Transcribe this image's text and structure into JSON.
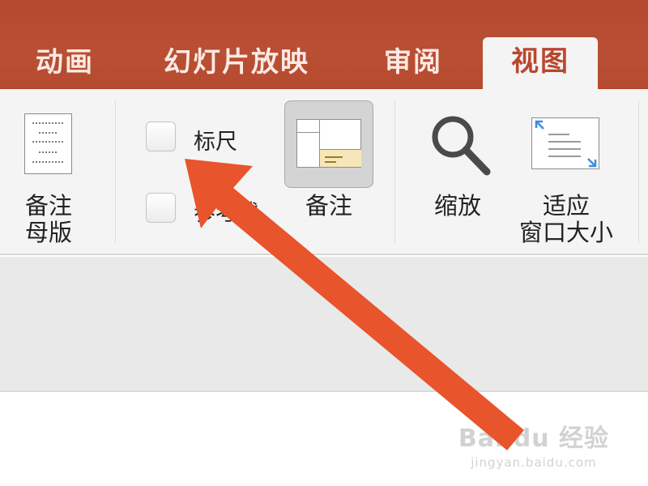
{
  "tabs": [
    {
      "label": "动画",
      "active": false
    },
    {
      "label": "幻灯片放映",
      "active": false
    },
    {
      "label": "审阅",
      "active": false
    },
    {
      "label": "视图",
      "active": true
    }
  ],
  "ribbon": {
    "notes_master": {
      "line1": "备注",
      "line2": "母版",
      "icon": "notes-master-icon"
    },
    "ruler": {
      "label": "标尺",
      "checked": false
    },
    "guides": {
      "label": "参考线",
      "checked": false
    },
    "notes": {
      "label": "备注",
      "pressed": true,
      "icon": "notes-pane-icon"
    },
    "zoom": {
      "label": "缩放",
      "icon": "magnifier-icon"
    },
    "fit_window": {
      "line1": "适应",
      "line2": "窗口大小",
      "icon": "fit-to-window-icon"
    }
  },
  "annotation": {
    "type": "arrow",
    "color": "#e8542c"
  },
  "watermark": {
    "main": "Bai du 经验",
    "sub": "jingyan.baidu.com"
  },
  "colors": {
    "tab_bar": "#b94f33",
    "active_tab_text": "#b8472f",
    "arrow": "#e8542c"
  }
}
